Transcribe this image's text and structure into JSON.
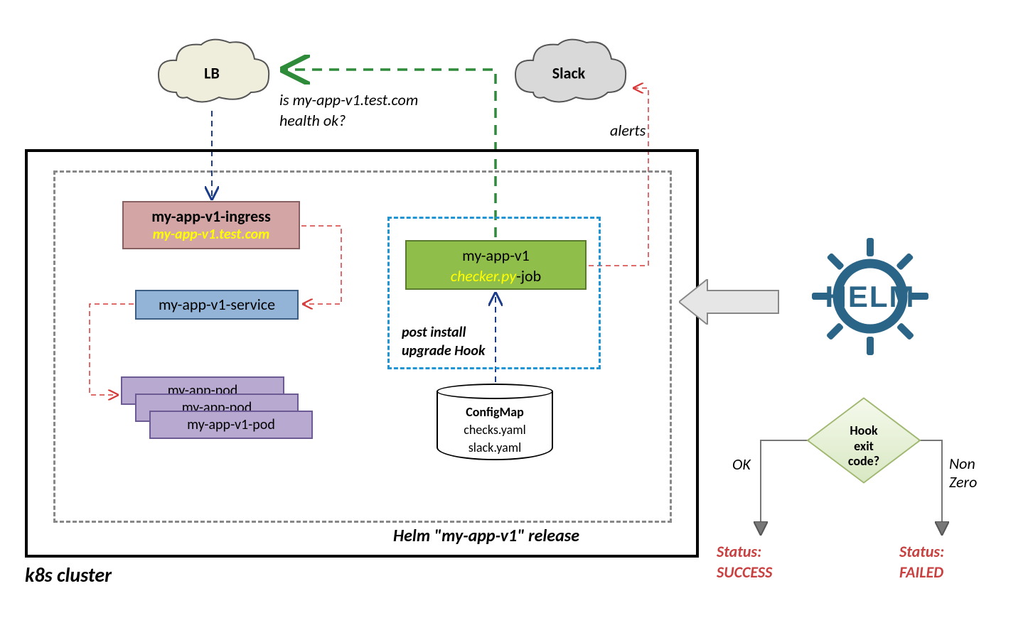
{
  "cluster": {
    "label": "k8s cluster"
  },
  "release": {
    "label": "Helm \"my-app-v1\" release"
  },
  "clouds": {
    "lb": "LB",
    "slack": "Slack"
  },
  "labels": {
    "health_question": "is my-app-v1.test.com health ok?",
    "alerts": "alerts",
    "ok": "OK",
    "nonzero": "Non Zero"
  },
  "ingress": {
    "title": "my-app-v1-ingress",
    "host": "my-app-v1.test.com"
  },
  "service": {
    "name": "my-app-v1-service"
  },
  "pods": {
    "p1": "my-app-pod",
    "p2": "my-app-pod",
    "p3": "my-app-v1-pod"
  },
  "hook": {
    "label": "post install upgrade Hook"
  },
  "job": {
    "app": "my-app-v1",
    "script": "checker.py",
    "suffix": "-job"
  },
  "configmap": {
    "title": "ConfigMap",
    "file1": "checks.yaml",
    "file2": "slack.yaml"
  },
  "helm": {
    "brand": "HELM"
  },
  "decision": {
    "label": "Hook exit code?"
  },
  "outcomes": {
    "success": "Status: SUCCESS",
    "failed": "Status: FAILED"
  }
}
